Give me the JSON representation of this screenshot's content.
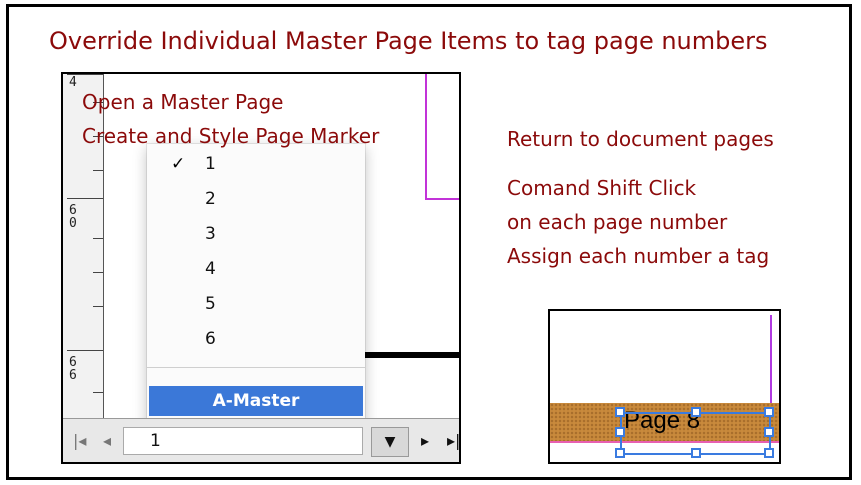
{
  "title": "Override Individual Master Page Items to tag page numbers",
  "left_annotations": {
    "open": "Open a Master Page",
    "create": "Create and Style Page Marker"
  },
  "right_annotations": {
    "return": "Return to document pages",
    "line1": "Comand Shift Click",
    "line2": "on each page number",
    "line3": "Assign each number a tag"
  },
  "ruler": {
    "top_number": "4",
    "mid_number": [
      "6",
      "0"
    ],
    "low_number": [
      "6",
      "6"
    ]
  },
  "page_menu": {
    "items": [
      "1",
      "2",
      "3",
      "4",
      "5",
      "6"
    ],
    "checked_index": 0,
    "check_mark": "✓",
    "master_item": "A-Master"
  },
  "bottom_bar": {
    "first_page_icon": "first-page-icon",
    "prev_page_icon": "prev-page-icon",
    "current_page": "1",
    "dropdown_icon": "▼",
    "next_page_icon": "next-page-icon"
  },
  "page_marker_example": {
    "text": "Page 8"
  },
  "colors": {
    "annotation_text": "#8b0a0a",
    "selection_blue": "#3b78d8",
    "guide_magenta": "#c233d8",
    "marker_fill": "#c98a3c"
  }
}
